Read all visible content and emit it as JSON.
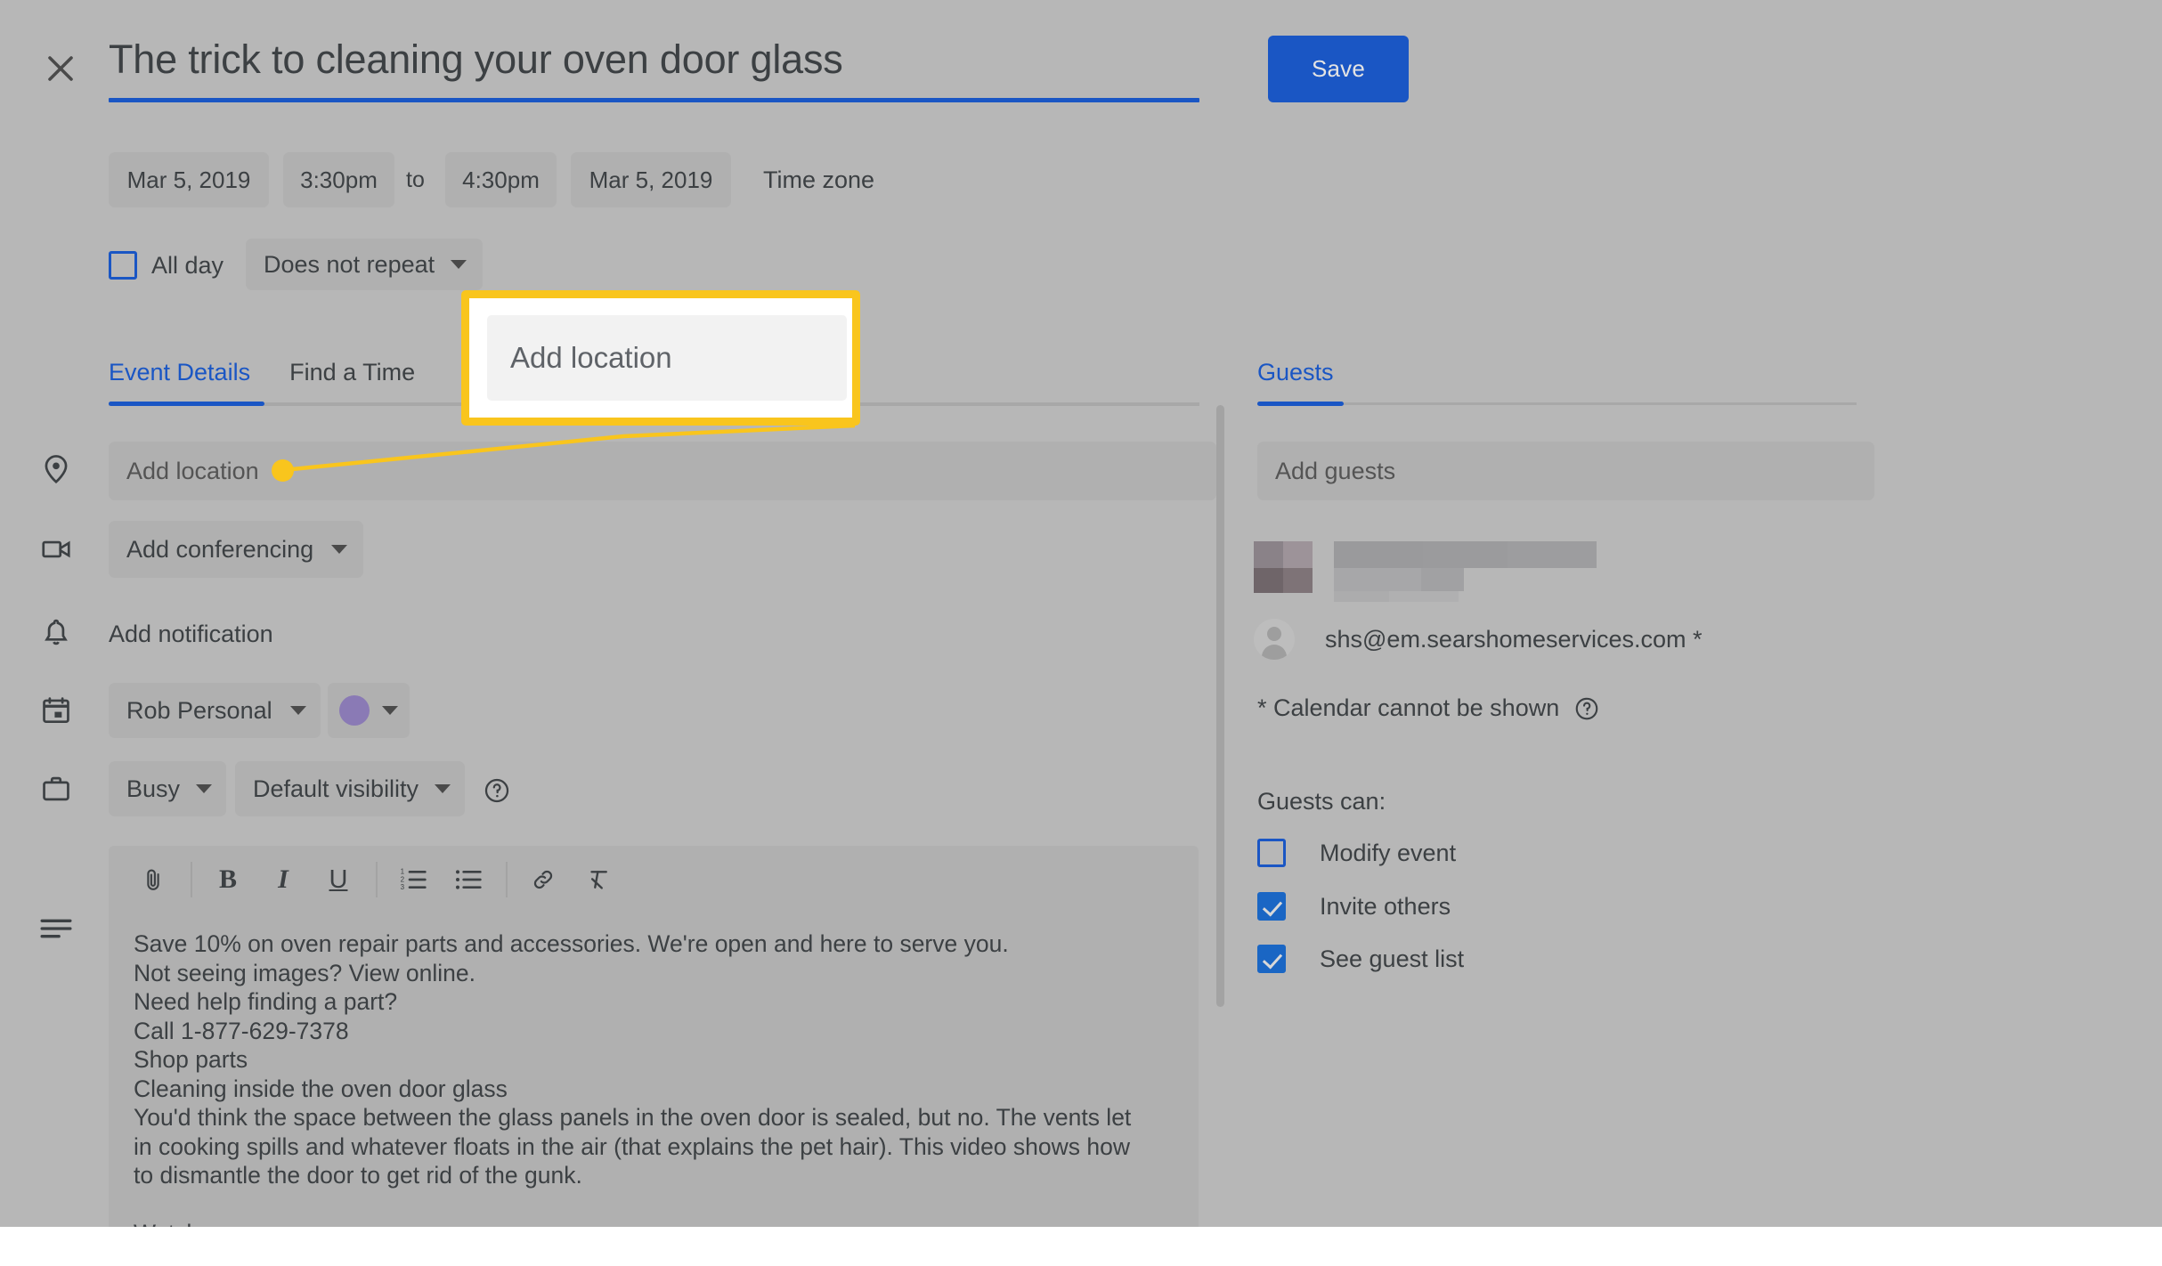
{
  "header": {
    "close_icon": "close-icon",
    "title": "The trick to cleaning your oven door glass",
    "save_label": "Save"
  },
  "datetime": {
    "start_date": "Mar 5, 2019",
    "start_time": "3:30pm",
    "to_label": "to",
    "end_time": "4:30pm",
    "end_date": "Mar 5, 2019",
    "timezone_label": "Time zone",
    "all_day_label": "All day",
    "all_day_checked": false,
    "repeat_label": "Does not repeat"
  },
  "tabs": {
    "event_details": "Event Details",
    "find_a_time": "Find a Time",
    "active": "Event Details"
  },
  "form": {
    "location_placeholder": "Add location",
    "location_icon": "location-pin-icon",
    "conferencing_label": "Add conferencing",
    "conferencing_icon": "video-camera-icon",
    "notification_label": "Add notification",
    "notification_icon": "bell-icon",
    "calendar_label": "Rob Personal",
    "calendar_icon": "calendar-icon",
    "color_value": "#8a7ab5",
    "busy_label": "Busy",
    "busy_icon": "briefcase-icon",
    "visibility_label": "Default visibility",
    "visibility_help_icon": "help-circle-icon"
  },
  "editor": {
    "description_icon": "description-lines-icon",
    "toolbar": [
      {
        "name": "attach-icon",
        "label": "Attach file"
      },
      {
        "name": "bold-icon",
        "label": "B"
      },
      {
        "name": "italic-icon",
        "label": "I"
      },
      {
        "name": "underline-icon",
        "label": "U"
      },
      {
        "name": "numbered-list-icon",
        "label": "Numbered list"
      },
      {
        "name": "bulleted-list-icon",
        "label": "Bulleted list"
      },
      {
        "name": "link-icon",
        "label": "Insert link"
      },
      {
        "name": "clear-formatting-icon",
        "label": "Remove formatting"
      }
    ],
    "body": "Save 10% on oven repair parts and accessories. We're open and here to serve you.\nNot seeing images? View online.\nNeed help finding a part?\nCall 1-877-629-7378\nShop parts\nCleaning inside the oven door glass\nYou'd think the space between the glass panels in the oven door is sealed, but no. The vents let\nin cooking spills and whatever floats in the air (that explains the pet hair). This video shows how\nto dismantle the door to get rid of the gunk.\n\nWatch now"
  },
  "guests": {
    "tab_label": "Guests",
    "add_guests_placeholder": "Add guests",
    "blurred_guest": "redacted",
    "guest_email": "shs@em.searshomeservices.com *",
    "guest_avatar_icon": "person-avatar-icon",
    "calendar_note": "* Calendar cannot be shown",
    "calendar_note_help_icon": "help-circle-icon",
    "guests_can_label": "Guests can:",
    "permissions": [
      {
        "label": "Modify event",
        "checked": false
      },
      {
        "label": "Invite others",
        "checked": true
      },
      {
        "label": "See guest list",
        "checked": true
      }
    ]
  },
  "callout": {
    "text": "Add location",
    "border_color": "#f9c51d",
    "dot_color": "#f9c51d"
  },
  "colors": {
    "accent_blue": "#1a56c4",
    "dim_overlay": "#b7b7b7",
    "field_grey": "#b0b0b0",
    "text_dark": "#3c4043",
    "highlight_yellow": "#f9c51d"
  }
}
